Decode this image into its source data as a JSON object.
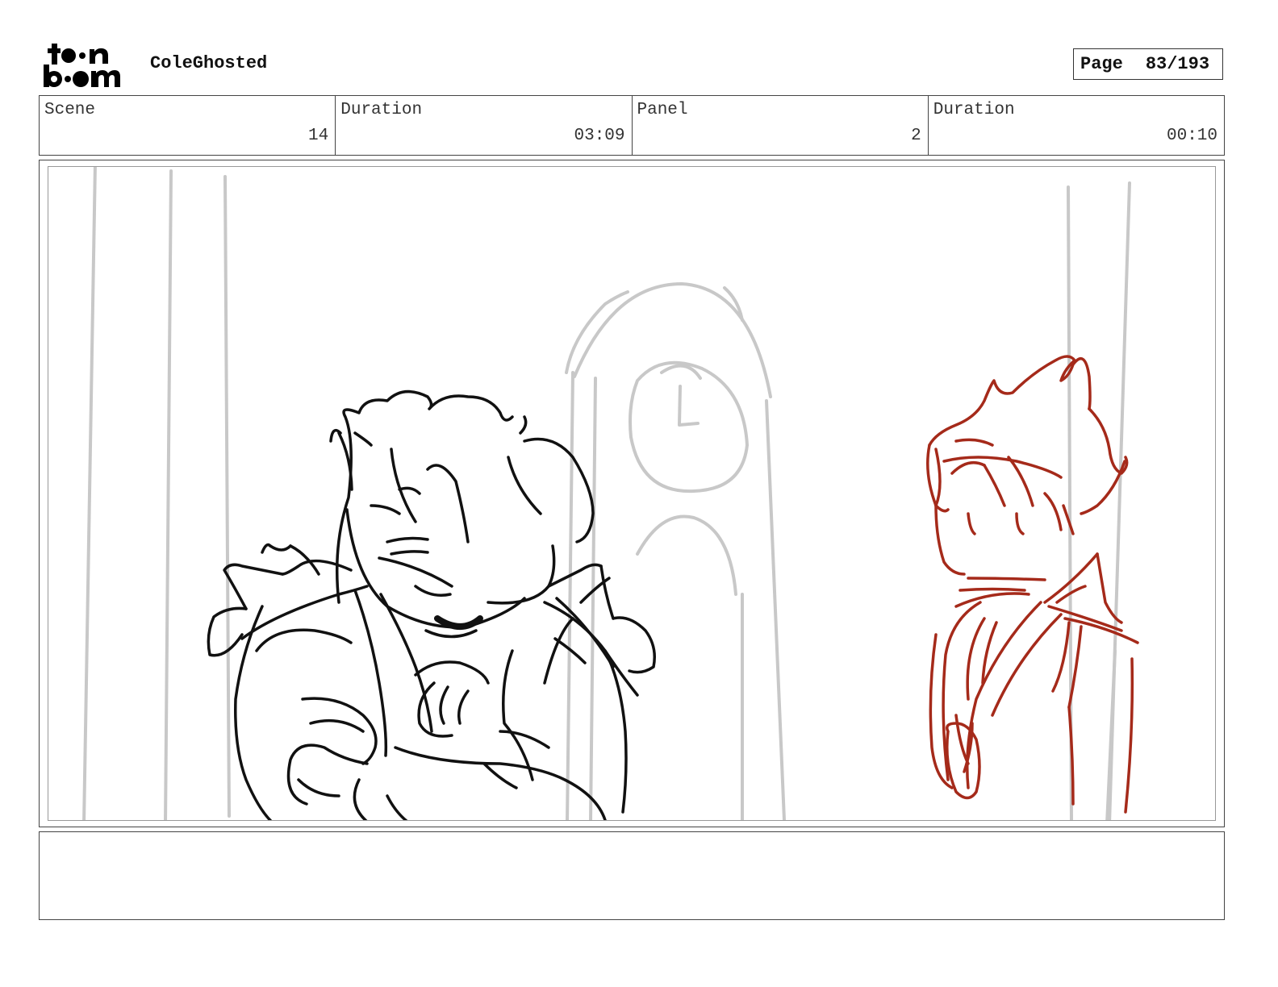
{
  "header": {
    "logo_text": "toon boom",
    "project_title": "ColeGhosted",
    "page_label": "Page",
    "page_number": "83/193"
  },
  "info": {
    "scene_label": "Scene",
    "scene_value": "14",
    "scene_duration_label": "Duration",
    "scene_duration_value": "03:09",
    "panel_label": "Panel",
    "panel_value": "2",
    "panel_duration_label": "Duration",
    "panel_duration_value": "00:10"
  },
  "colors": {
    "sketch_black": "#111111",
    "sketch_red": "#a52a1a",
    "sketch_gray": "#c8c8c8"
  },
  "notes": {
    "text": ""
  }
}
